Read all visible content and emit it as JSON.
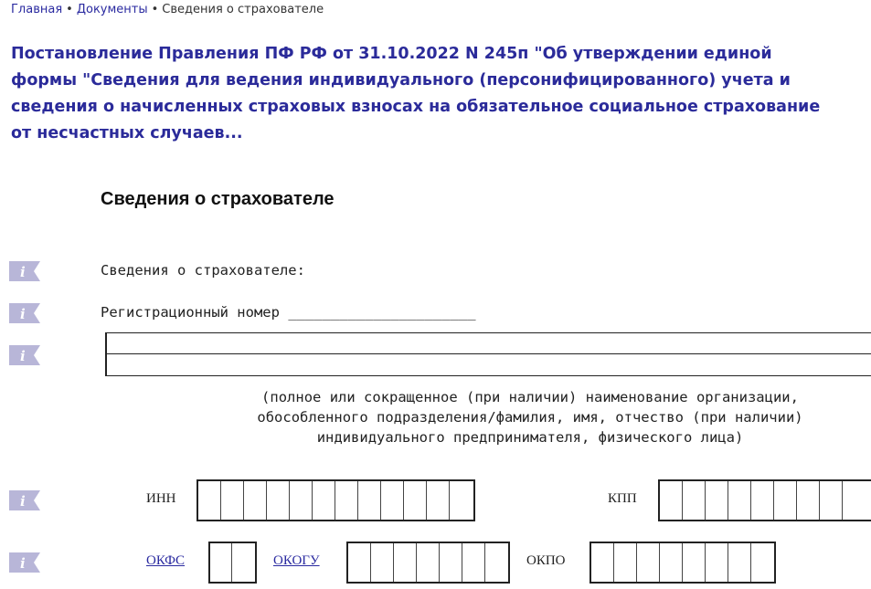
{
  "breadcrumb": {
    "home": "Главная",
    "separator": "•",
    "documents": "Документы",
    "current": "Сведения о страхователе"
  },
  "document_title": "Постановление Правления ПФ РФ от 31.10.2022 N 245п \"Об утверждении единой формы \"Сведения для ведения индивидуального (персонифицированного) учета и сведения о начисленных страховых взносах на обязательное социальное страхование от несчастных случаев...",
  "form": {
    "heading": "Сведения о страхователе",
    "section_label": "Сведения о страхователе:",
    "reg_number_label": "Регистрационный номер",
    "reg_number_blank": "______________________",
    "caption_line1": "(полное или сокращенное (при наличии) наименование организации,",
    "caption_line2": "обособленного подразделения/фамилия, имя, отчество (при наличии)",
    "caption_line3": "индивидуального предпринимателя, физического лица)",
    "inn_label": "ИНН",
    "kpp_label": "КПП",
    "okfs_label": "ОКФС",
    "okogu_label": "ОКОГУ",
    "okpo_label": "ОКПО"
  },
  "colors": {
    "link": "#2a2aa0",
    "title": "#2b2b9a",
    "info_icon": "#b8b6d8"
  },
  "icons": {
    "info": "info-icon"
  }
}
